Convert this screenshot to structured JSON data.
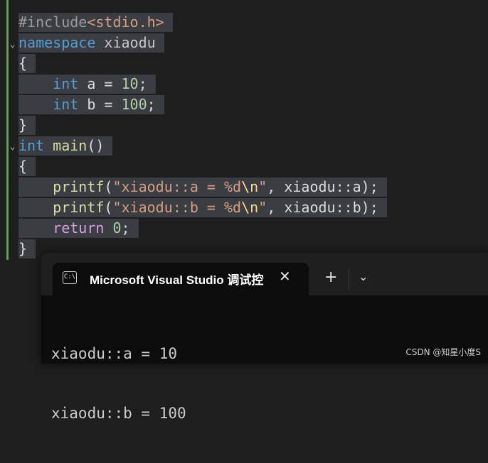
{
  "editor": {
    "lines": [
      {
        "parts": [
          {
            "t": "#include",
            "c": "pp"
          },
          {
            "t": "<stdio.h>",
            "c": "hdr"
          }
        ]
      },
      {
        "parts": [
          {
            "t": "namespace",
            "c": "kw"
          },
          {
            "t": " xiaodu",
            "c": "ns"
          }
        ]
      },
      {
        "parts": [
          {
            "t": "{",
            "c": "var"
          }
        ]
      },
      {
        "parts": [
          {
            "t": "    int",
            "c": "kw"
          },
          {
            "t": " a = ",
            "c": "var"
          },
          {
            "t": "10",
            "c": "num"
          },
          {
            "t": ";",
            "c": "var"
          }
        ]
      },
      {
        "parts": [
          {
            "t": "    int",
            "c": "kw"
          },
          {
            "t": " b = ",
            "c": "var"
          },
          {
            "t": "100",
            "c": "num"
          },
          {
            "t": ";",
            "c": "var"
          }
        ]
      },
      {
        "parts": [
          {
            "t": "}",
            "c": "var"
          }
        ]
      },
      {
        "parts": [
          {
            "t": "int",
            "c": "kw"
          },
          {
            "t": " ",
            "c": "var"
          },
          {
            "t": "main",
            "c": "fn"
          },
          {
            "t": "()",
            "c": "var"
          }
        ]
      },
      {
        "parts": [
          {
            "t": "{",
            "c": "var"
          }
        ]
      },
      {
        "parts": [
          {
            "t": "    printf",
            "c": "fn"
          },
          {
            "t": "(",
            "c": "var"
          },
          {
            "t": "\"xiaodu::a = %d",
            "c": "str"
          },
          {
            "t": "\\n",
            "c": "esc"
          },
          {
            "t": "\"",
            "c": "str"
          },
          {
            "t": ", xiaodu::a);",
            "c": "var"
          }
        ]
      },
      {
        "parts": [
          {
            "t": "    printf",
            "c": "fn"
          },
          {
            "t": "(",
            "c": "var"
          },
          {
            "t": "\"xiaodu::b = %d",
            "c": "str"
          },
          {
            "t": "\\n",
            "c": "esc"
          },
          {
            "t": "\"",
            "c": "str"
          },
          {
            "t": ", xiaodu::b);",
            "c": "var"
          }
        ]
      },
      {
        "parts": [
          {
            "t": "    return",
            "c": "ctl"
          },
          {
            "t": " ",
            "c": "var"
          },
          {
            "t": "0",
            "c": "num"
          },
          {
            "t": ";",
            "c": "var"
          }
        ]
      },
      {
        "parts": [
          {
            "t": "}",
            "c": "var"
          }
        ]
      }
    ]
  },
  "terminal": {
    "tab_title": "Microsoft Visual Studio 调试控制台",
    "tab_icon_text": "C:\\",
    "close_glyph": "✕",
    "new_tab_glyph": "+",
    "dropdown_glyph": "⌄",
    "output_lines": [
      "xiaodu::a = 10",
      "xiaodu::b = 100"
    ]
  },
  "watermark": "CSDN @知星小度S"
}
